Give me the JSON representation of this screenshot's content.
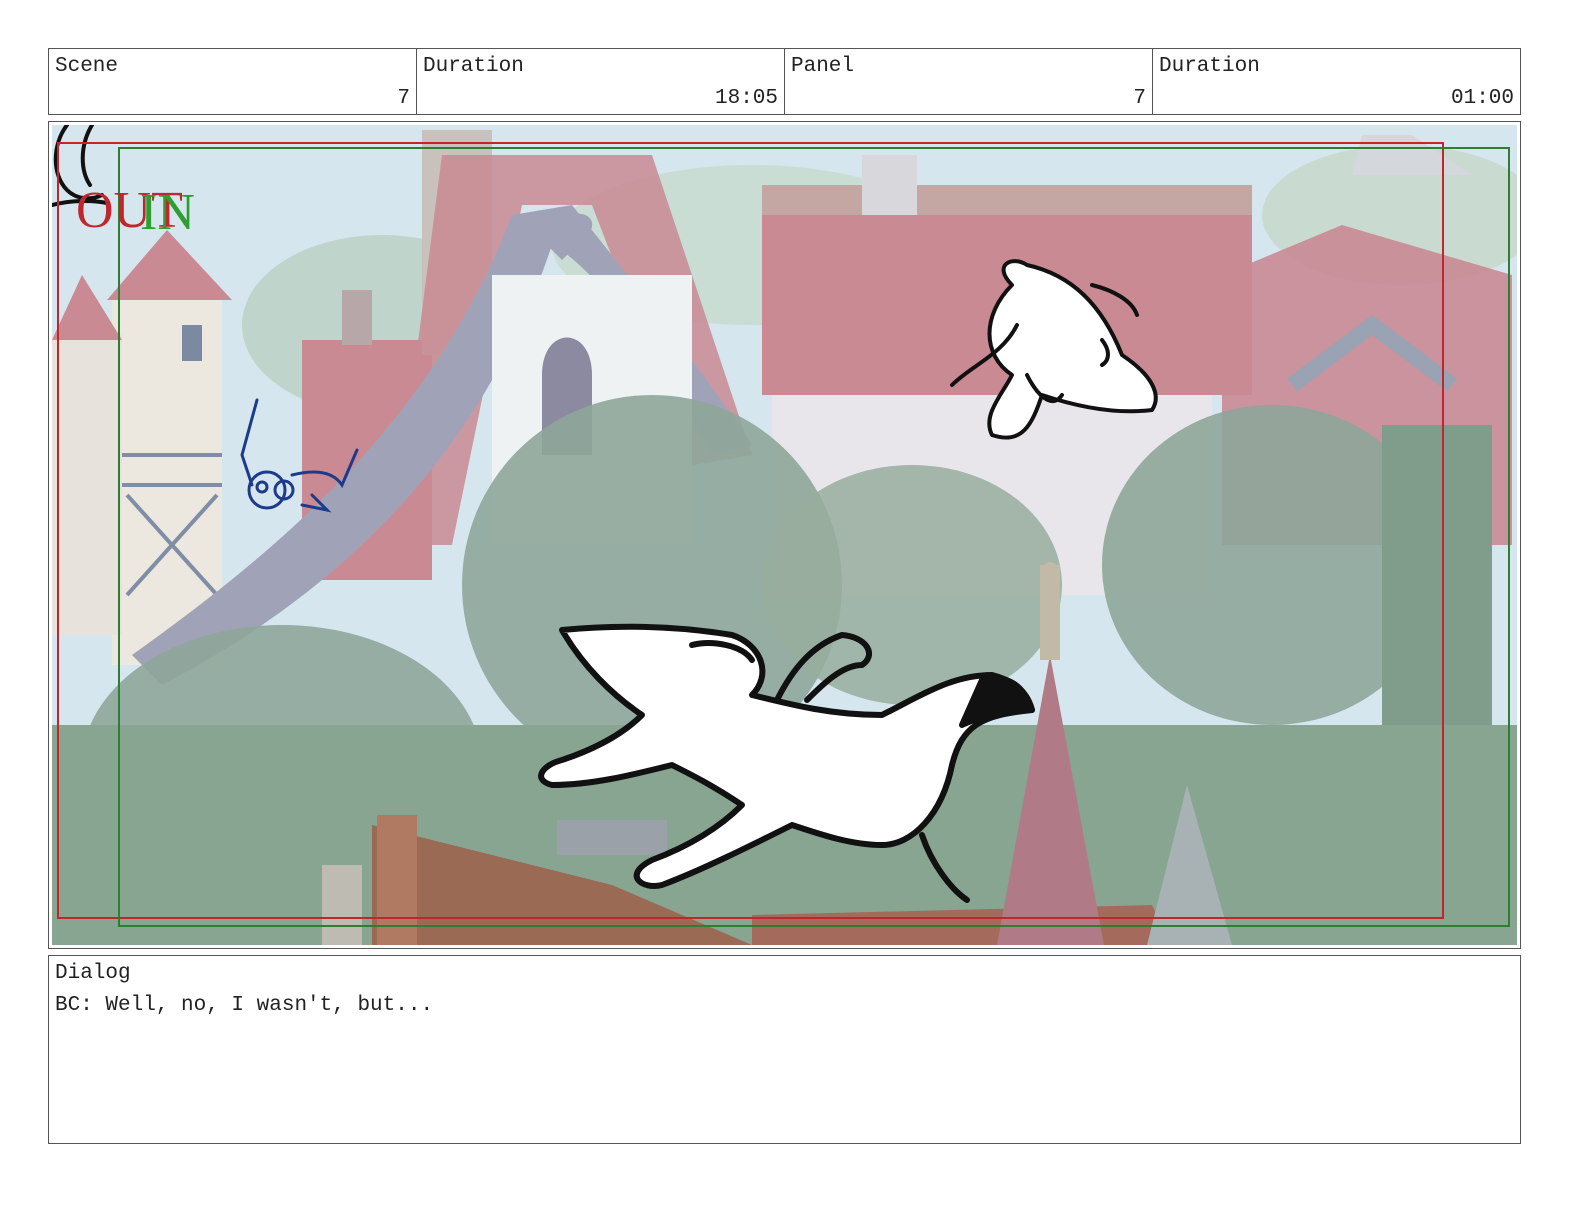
{
  "header": {
    "scene_label": "Scene",
    "scene_value": "7",
    "scene_duration_label": "Duration",
    "scene_duration_value": "18:05",
    "panel_label": "Panel",
    "panel_value": "7",
    "panel_duration_label": "Duration",
    "panel_duration_value": "01:00"
  },
  "panel": {
    "overlay_out_text": "OUT",
    "overlay_in_text": "IN",
    "colors": {
      "sky": "#cfe3ee",
      "roof": "#c98a93",
      "foliage": "#8fa89a",
      "ground": "#8aa894",
      "red_frame": "#c0272d",
      "green_frame": "#2e7d32",
      "blue_sketch": "#1e3a8a"
    }
  },
  "dialog": {
    "label": "Dialog",
    "line": "BC: Well, no, I wasn't, but..."
  }
}
